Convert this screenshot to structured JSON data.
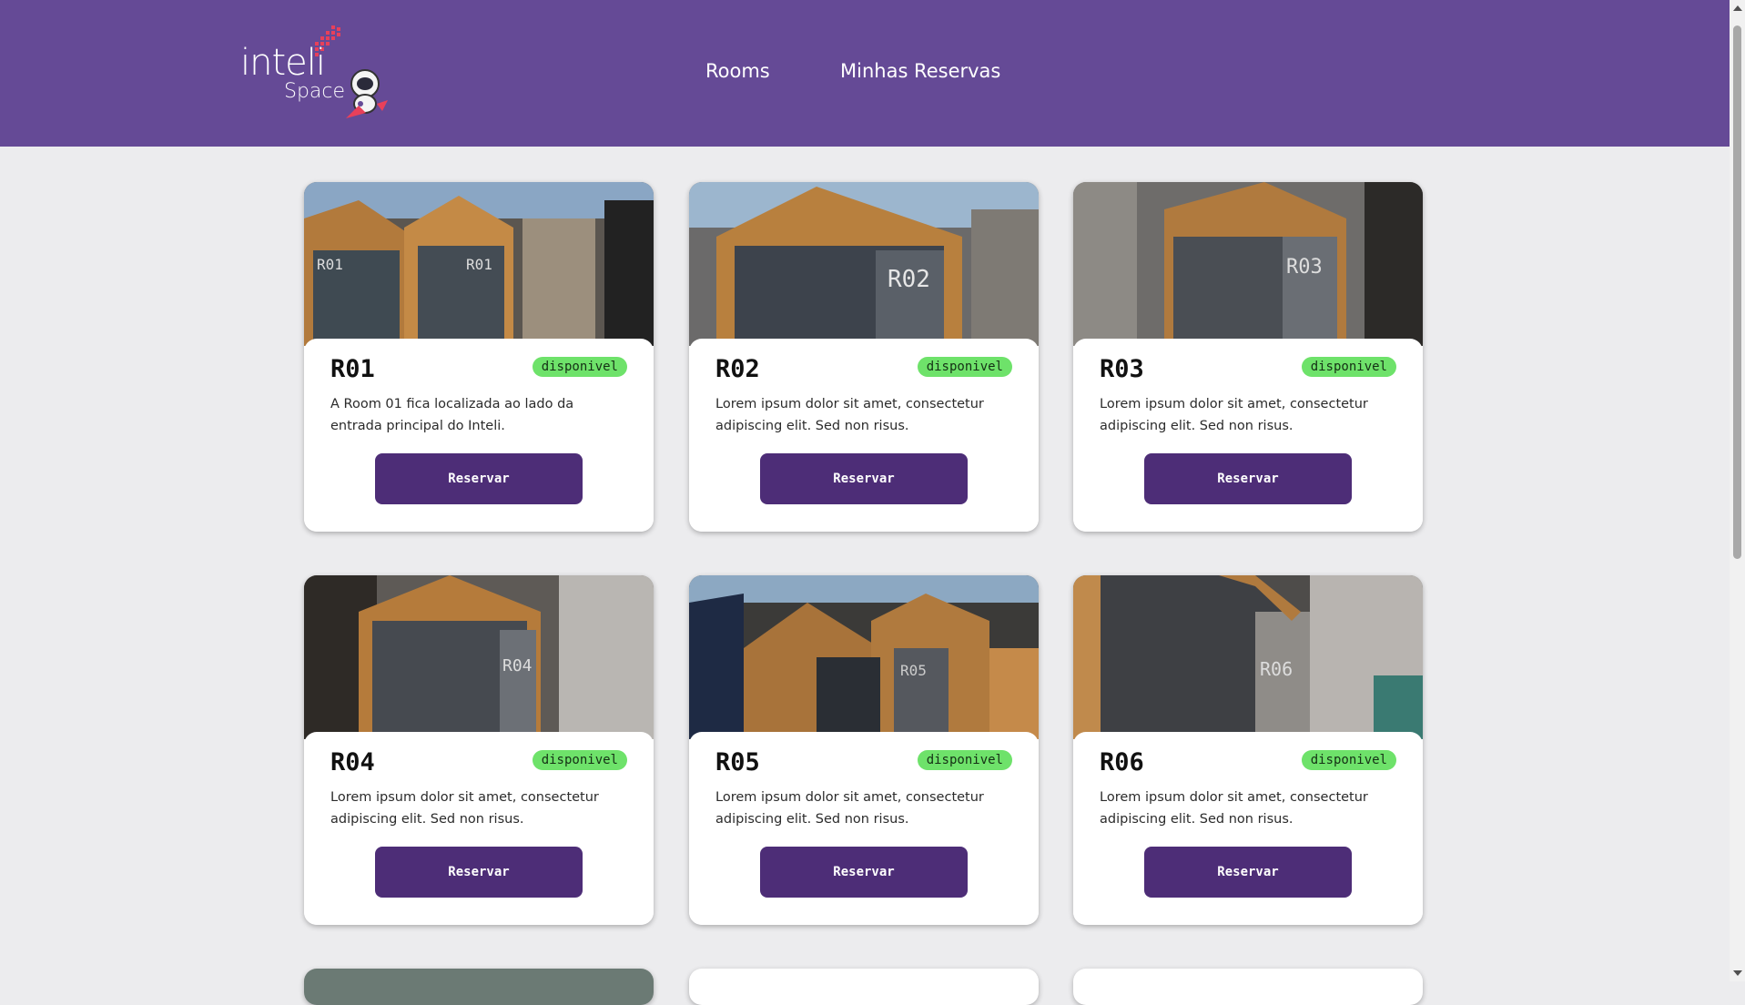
{
  "brand": {
    "name": "inteli",
    "subtitle": "Space"
  },
  "nav": [
    {
      "label": "Rooms"
    },
    {
      "label": "Minhas Reservas"
    }
  ],
  "rooms": [
    {
      "name": "R01",
      "status": "disponivel",
      "description": "A Room 01 fica localizada ao lado da entrada principal do Inteli.",
      "button": "Reservar",
      "photo_sign": "R01"
    },
    {
      "name": "R02",
      "status": "disponivel",
      "description": "Lorem ipsum dolor sit amet, consectetur adipiscing elit. Sed non risus.",
      "button": "Reservar",
      "photo_sign": "R02"
    },
    {
      "name": "R03",
      "status": "disponivel",
      "description": "Lorem ipsum dolor sit amet, consectetur adipiscing elit. Sed non risus.",
      "button": "Reservar",
      "photo_sign": "R03"
    },
    {
      "name": "R04",
      "status": "disponivel",
      "description": "Lorem ipsum dolor sit amet, consectetur adipiscing elit. Sed non risus.",
      "button": "Reservar",
      "photo_sign": "R04"
    },
    {
      "name": "R05",
      "status": "disponivel",
      "description": "Lorem ipsum dolor sit amet, consectetur adipiscing elit. Sed non risus.",
      "button": "Reservar",
      "photo_sign": "R05"
    },
    {
      "name": "R06",
      "status": "disponivel",
      "description": "Lorem ipsum dolor sit amet, consectetur adipiscing elit. Sed non risus.",
      "button": "Reservar",
      "photo_sign": "R06"
    }
  ],
  "colors": {
    "header": "#654a96",
    "button": "#4d2d77",
    "badge": "#6ee26a",
    "background": "#ececee"
  }
}
